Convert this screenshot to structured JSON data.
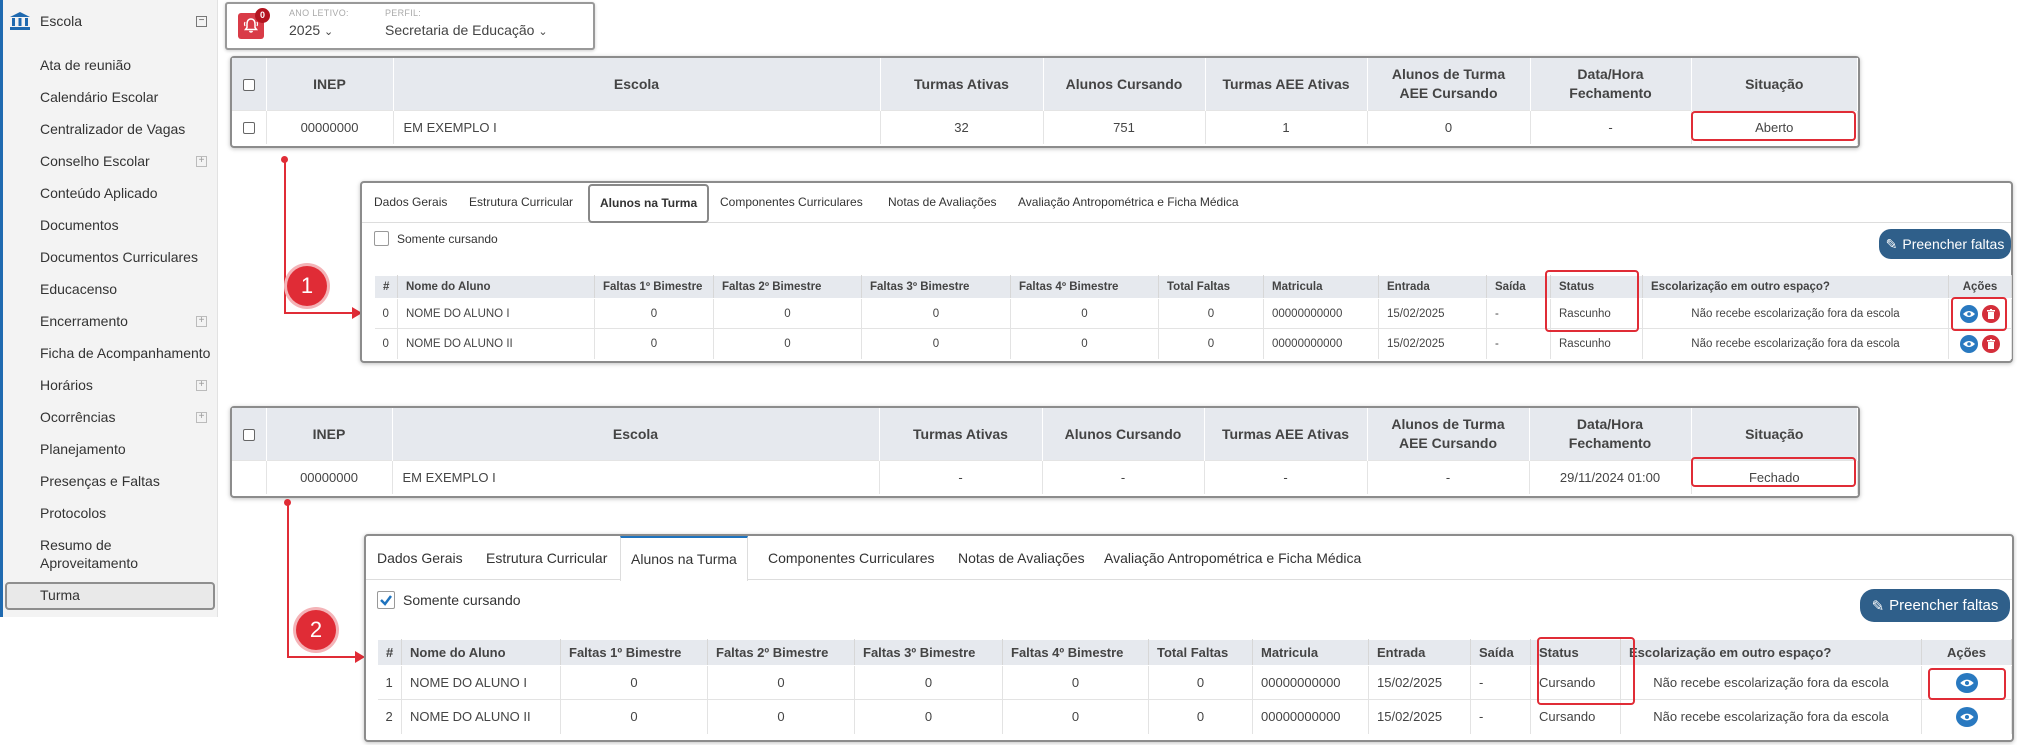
{
  "sidebar": {
    "title": "Escola",
    "items": [
      {
        "label": "Ata de reunião",
        "expandable": false
      },
      {
        "label": "Calendário Escolar",
        "expandable": false
      },
      {
        "label": "Centralizador de Vagas",
        "expandable": false
      },
      {
        "label": "Conselho Escolar",
        "expandable": true
      },
      {
        "label": "Conteúdo Aplicado",
        "expandable": false
      },
      {
        "label": "Documentos",
        "expandable": false
      },
      {
        "label": "Documentos Curriculares",
        "expandable": false
      },
      {
        "label": "Educacenso",
        "expandable": false
      },
      {
        "label": "Encerramento",
        "expandable": true
      },
      {
        "label": "Ficha de Acompanhamento",
        "expandable": false
      },
      {
        "label": "Horários",
        "expandable": true
      },
      {
        "label": "Ocorrências",
        "expandable": true
      },
      {
        "label": "Planejamento",
        "expandable": false
      },
      {
        "label": "Presenças e Faltas",
        "expandable": false
      },
      {
        "label": "Protocolos",
        "expandable": false
      },
      {
        "label": "Resumo de",
        "label2": "Aproveitamento",
        "expandable": false
      },
      {
        "label": "Turma",
        "expandable": false,
        "active": true
      }
    ]
  },
  "topbar": {
    "notification_count": "0",
    "ano_letivo_label": "ANO LETIVO:",
    "ano_letivo_value": "2025",
    "perfil_label": "PERFIL:",
    "perfil_value": "Secretaria de Educação"
  },
  "school_table": {
    "headers": [
      "INEP",
      "Escola",
      "Turmas Ativas",
      "Alunos Cursando",
      "Turmas AEE Ativas",
      "Alunos de Turma",
      "AEE Cursando",
      "Data/Hora",
      "Fechamento",
      "Situação"
    ],
    "rows": [
      {
        "inep": "00000000",
        "escola": "EM EXEMPLO I",
        "turmas_ativas": "32",
        "alunos_cursando": "751",
        "turmas_aee": "1",
        "alunos_aee": "0",
        "data_hora": "-",
        "situacao": "Aberto"
      },
      {
        "inep": "00000000",
        "escola": "EM EXEMPLO I",
        "turmas_ativas": "-",
        "alunos_cursando": "-",
        "turmas_aee": "-",
        "alunos_aee": "-",
        "data_hora": "29/11/2024 01:00",
        "situacao": "Fechado"
      }
    ]
  },
  "steps": [
    "1",
    "2"
  ],
  "turma_panel": {
    "tabs": [
      "Dados Gerais",
      "Estrutura Curricular",
      "Alunos na Turma",
      "Componentes Curriculares",
      "Notas de Avaliações",
      "Avaliação Antropométrica e Ficha Médica"
    ],
    "somente_cursando": "Somente cursando",
    "preencher_faltas": "Preencher faltas",
    "columns": [
      "#",
      "Nome do Aluno",
      "Faltas 1º Bimestre",
      "Faltas 2º Bimestre",
      "Faltas 3º Bimestre",
      "Faltas 4º Bimestre",
      "Total Faltas",
      "Matricula",
      "Entrada",
      "Saída",
      "Status",
      "Escolarização em outro espaço?",
      "Ações"
    ],
    "panel1_rows": [
      {
        "n": "0",
        "nome": "NOME DO ALUNO I",
        "f1": "0",
        "f2": "0",
        "f3": "0",
        "f4": "0",
        "total": "0",
        "matricula": "00000000000",
        "entrada": "15/02/2025",
        "saida": "-",
        "status": "Rascunho",
        "escolarizacao": "Não recebe escolarização fora da escola"
      },
      {
        "n": "0",
        "nome": "NOME DO ALUNO II",
        "f1": "0",
        "f2": "0",
        "f3": "0",
        "f4": "0",
        "total": "0",
        "matricula": "00000000000",
        "entrada": "15/02/2025",
        "saida": "-",
        "status": "Rascunho",
        "escolarizacao": "Não recebe escolarização fora da escola"
      }
    ],
    "panel2_rows": [
      {
        "n": "1",
        "nome": "NOME DO ALUNO I",
        "f1": "0",
        "f2": "0",
        "f3": "0",
        "f4": "0",
        "total": "0",
        "matricula": "00000000000",
        "entrada": "15/02/2025",
        "saida": "-",
        "status": "Cursando",
        "escolarizacao": "Não recebe escolarização fora da escola"
      },
      {
        "n": "2",
        "nome": "NOME DO ALUNO II",
        "f1": "0",
        "f2": "0",
        "f3": "0",
        "f4": "0",
        "total": "0",
        "matricula": "00000000000",
        "entrada": "15/02/2025",
        "saida": "-",
        "status": "Cursando",
        "escolarizacao": "Não recebe escolarização fora da escola"
      }
    ]
  },
  "colors": {
    "accent_red": "#e02c36",
    "header_gray": "#e6e9ee",
    "button_blue": "#2f5f8a",
    "eye_blue": "#2979c0",
    "delete_red": "#d42f3b"
  }
}
